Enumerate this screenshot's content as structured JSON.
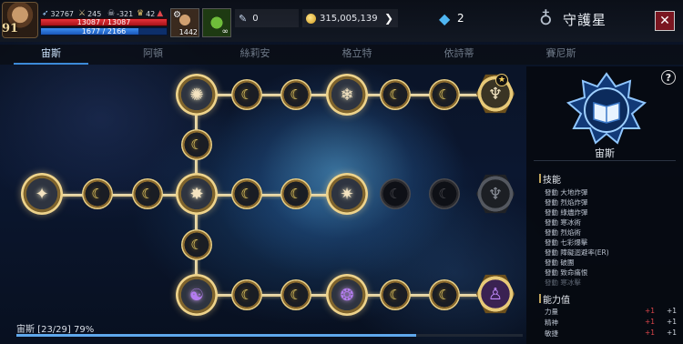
{
  "player": {
    "level": "91",
    "power": "32767",
    "stat_a": "245",
    "stat_b": "-321",
    "stat_c": "42",
    "hp": "13087 / 13087",
    "hp_fraction": 1.0,
    "mp": "1677 / 2166",
    "mp_fraction": 0.774
  },
  "slots": {
    "slot1_count": "1442",
    "slot2_label": "∞"
  },
  "resources": {
    "item_count": "0",
    "gold": "315,005,139",
    "crystal_count": "2"
  },
  "header": {
    "title": "守護星",
    "close_label": "✕"
  },
  "tabs": [
    "宙斯",
    "阿頓",
    "絲莉安",
    "格立特",
    "依詩蒂",
    "賽尼斯"
  ],
  "active_tab": 0,
  "tree": {
    "moon_glyph": "☾",
    "star_glyph": "★"
  },
  "progress": {
    "label": "宙斯 [23/29] 79%",
    "fraction": 0.79
  },
  "panel": {
    "help_label": "?",
    "constellation_name": "宙斯",
    "skills_title": "技能",
    "skills": [
      "發動 大地炸彈",
      "發動 烈焰炸彈",
      "發動 綠燼炸彈",
      "發動 寒冰術",
      "發動 烈焰術",
      "發動 七彩爆擊",
      "發動 障礙迴避率(ER)",
      "發動 破團",
      "發動 致命痛恨",
      "發動 寒冰擊"
    ],
    "attributes_title": "能力值",
    "attributes": [
      {
        "name": "力量",
        "v1": "+1",
        "v2": "+1"
      },
      {
        "name": "精神",
        "v1": "+1",
        "v2": "+1"
      },
      {
        "name": "敏捷",
        "v1": "+1",
        "v2": "+1"
      }
    ]
  },
  "colors": {
    "accent_blue": "#3c8ad8",
    "gold": "#eed38b",
    "hp_red": "#e8323a",
    "mp_blue": "#3c8ef0"
  }
}
